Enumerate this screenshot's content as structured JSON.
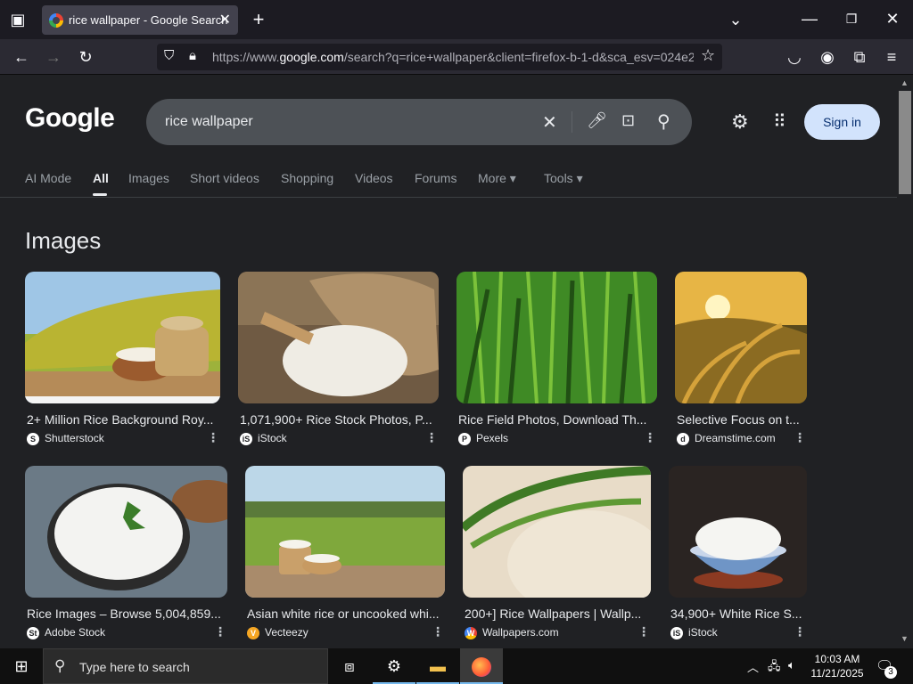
{
  "browser": {
    "tab_title": "rice wallpaper - Google Search",
    "url_prefix": "https://www.",
    "url_domain": "google.com",
    "url_rest": "/search?q=rice+wallpaper&client=firefox-b-1-d&sca_esv=024e2"
  },
  "google": {
    "logo": "Google",
    "query": "rice wallpaper",
    "signin_label": "Sign in",
    "tabs": [
      {
        "label": "AI Mode"
      },
      {
        "label": "All"
      },
      {
        "label": "Images"
      },
      {
        "label": "Short videos"
      },
      {
        "label": "Shopping"
      },
      {
        "label": "Videos"
      },
      {
        "label": "Forums"
      },
      {
        "label": "More ▾"
      },
      {
        "label": "Tools ▾"
      }
    ],
    "section_title": "Images",
    "results": [
      {
        "title": "2+ Million Rice Background Roy...",
        "source": "Shutterstock",
        "favicon": "S"
      },
      {
        "title": "1,071,900+ Rice Stock Photos, P...",
        "source": "iStock",
        "favicon": "iS"
      },
      {
        "title": "Rice Field Photos, Download Th...",
        "source": "Pexels",
        "favicon": "P"
      },
      {
        "title": "Selective Focus on t...",
        "source": "Dreamstime.com",
        "favicon": "d"
      },
      {
        "title": "Rice Images – Browse 5,004,859...",
        "source": "Adobe Stock",
        "favicon": "St"
      },
      {
        "title": "Asian white rice or uncooked whi...",
        "source": "Vecteezy",
        "favicon": "V"
      },
      {
        "title": "200+] Rice Wallpapers | Wallp...",
        "source": "Wallpapers.com",
        "favicon": "W"
      },
      {
        "title": "34,900+ White Rice S...",
        "source": "iStock",
        "favicon": "iS"
      }
    ]
  },
  "taskbar": {
    "search_placeholder": "Type here to search",
    "time": "10:03 AM",
    "date": "11/21/2025",
    "notification_count": "3"
  }
}
